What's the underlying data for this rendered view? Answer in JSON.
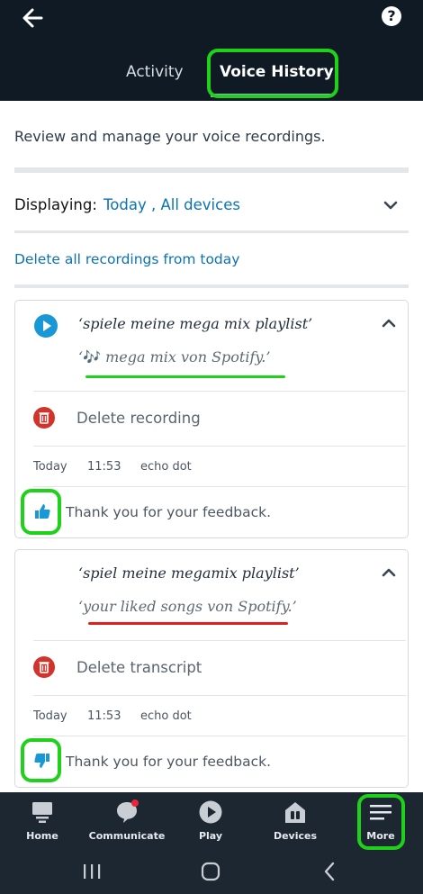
{
  "header": {
    "tabs": [
      {
        "label": "Activity",
        "selected": false
      },
      {
        "label": "Voice History",
        "selected": true
      }
    ],
    "back_icon": "arrow-left-icon",
    "help_icon": "help-icon",
    "help_glyph": "?"
  },
  "intro": "Review and manage your voice recordings.",
  "filter": {
    "label": "Displaying:",
    "value": "Today , All devices"
  },
  "delete_all_label": "Delete all recordings from today",
  "recordings": [
    {
      "utterance": "‘spiele meine mega mix playlist’",
      "response_prefix": "‘",
      "response_emoji": "🎶",
      "response_text": "mega mix von Spotify.’",
      "delete_label": "Delete recording",
      "date": "Today",
      "time": "11:53",
      "device": "echo dot",
      "feedback": "Thank you for your feedback.",
      "feedback_type": "thumbs-up",
      "underline_color": "#1fd11a"
    },
    {
      "utterance": "‘spiel meine megamix playlist’",
      "response_text": "‘your liked songs von Spotify.’",
      "delete_label": "Delete transcript",
      "date": "Today",
      "time": "11:53",
      "device": "echo dot",
      "feedback": "Thank you for your feedback.",
      "feedback_type": "thumbs-down",
      "underline_color": "#e0201b"
    }
  ],
  "bottom_nav": [
    {
      "label": "Home",
      "icon": "home-icon"
    },
    {
      "label": "Communicate",
      "icon": "communicate-icon"
    },
    {
      "label": "Play",
      "icon": "play-icon"
    },
    {
      "label": "Devices",
      "icon": "devices-icon"
    },
    {
      "label": "More",
      "icon": "menu-icon"
    }
  ],
  "colors": {
    "header_bg": "#0f1a24",
    "link": "#0b73b3",
    "highlight": "#1fd11a",
    "play": "#1a98d5",
    "trash": "#d0342c"
  }
}
